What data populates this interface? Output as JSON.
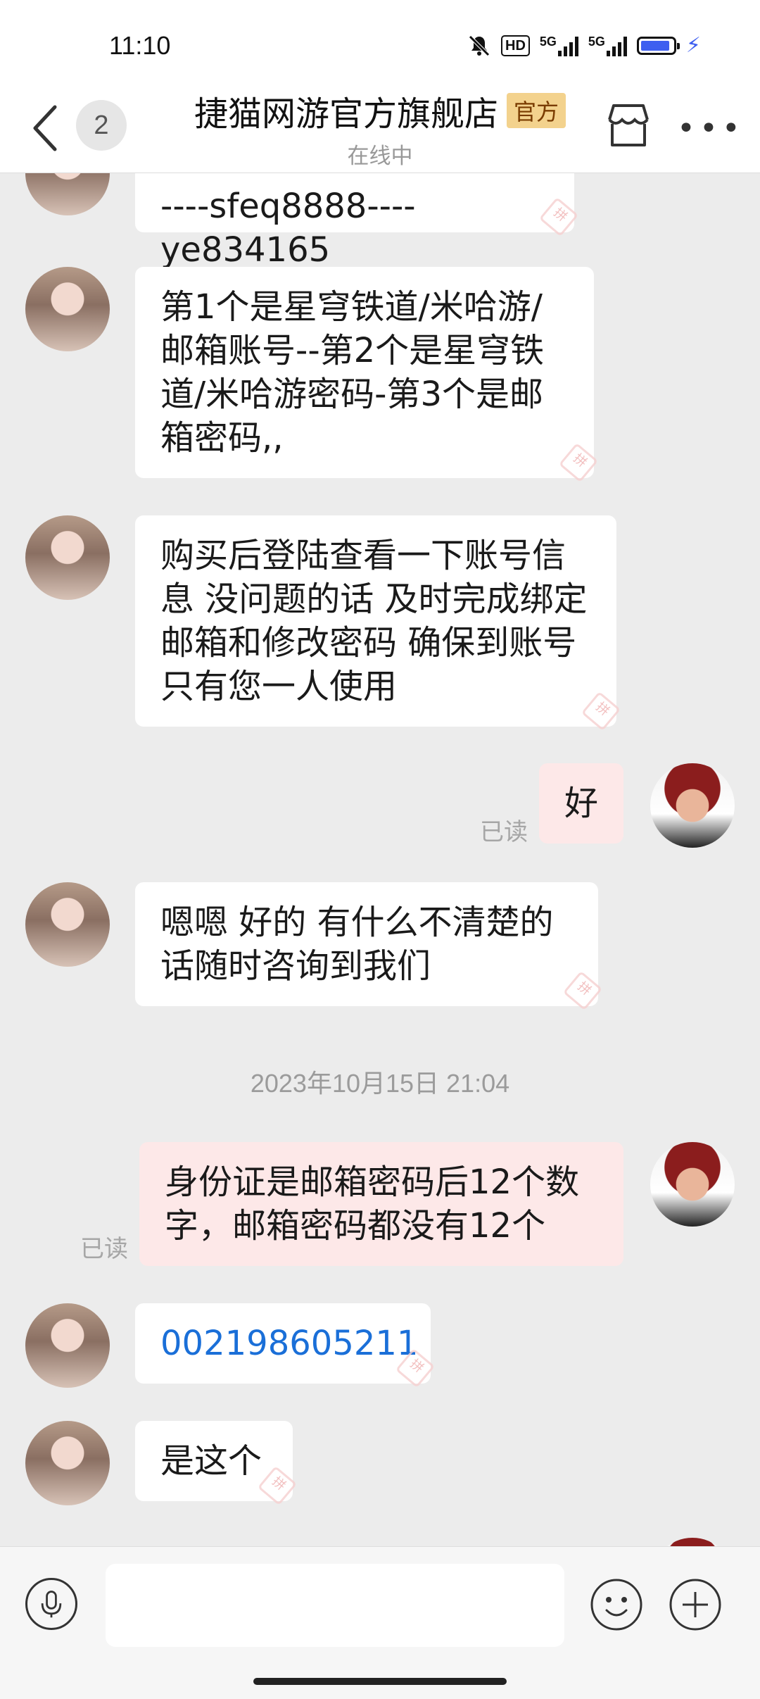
{
  "status_bar": {
    "time": "11:10",
    "hd_label": "HD",
    "sig1_label": "5G",
    "sig2_label": "5G",
    "icons": [
      "mute-bell-icon",
      "hd-voice-icon",
      "signal-5g-icon",
      "signal-5g-icon",
      "battery-icon",
      "charging-bolt-icon"
    ]
  },
  "header": {
    "unread_count": "2",
    "shop_name": "捷猫网游官方旗舰店",
    "official_badge": "官方",
    "online_status": "在线中"
  },
  "messages": [
    {
      "side": "left",
      "text": "----sfeq8888----ye834165"
    },
    {
      "side": "left",
      "text": "第1个是星穹铁道/米哈游/邮箱账号--第2个是星穹铁道/米哈游密码-第3个是邮箱密码,,"
    },
    {
      "side": "left",
      "text": "购买后登陆查看一下账号信息 没问题的话 及时完成绑定邮箱和修改密码 确保到账号只有您一人使用"
    },
    {
      "side": "right",
      "text": "好",
      "read_label": "已读"
    },
    {
      "side": "left",
      "text": "嗯嗯 好的 有什么不清楚的话随时咨询到我们"
    },
    {
      "side": "right",
      "text": "身份证是邮箱密码后12个数字，邮箱密码都没有12个",
      "read_label": "已读"
    },
    {
      "side": "left",
      "text": "002198605211",
      "is_link": true
    },
    {
      "side": "left",
      "text": "是这个"
    }
  ],
  "timestamp": "2023年10月15日 21:04",
  "colors": {
    "chat_background": "#ececec",
    "received_bubble": "#ffffff",
    "sent_bubble": "#fde8e8",
    "link_text": "#1a6fd8",
    "official_badge_bg": "#f3d28d"
  }
}
